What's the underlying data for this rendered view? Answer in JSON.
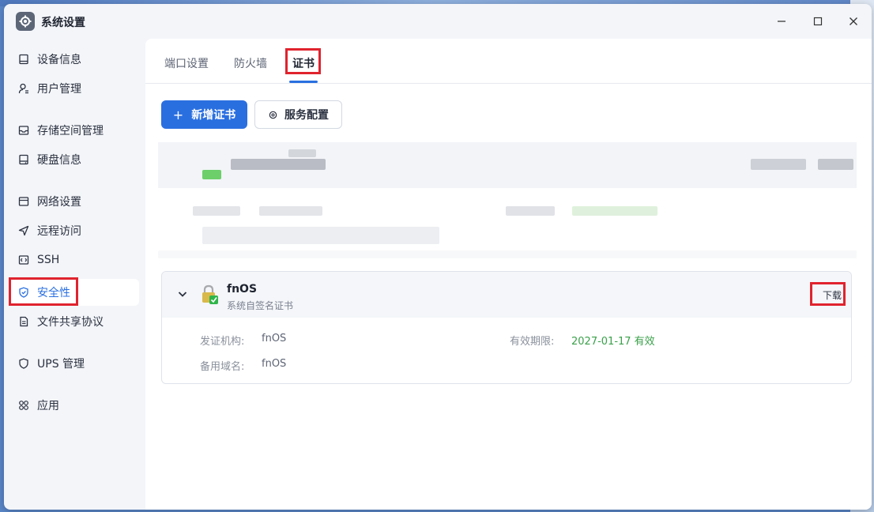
{
  "window": {
    "title": "系统设置"
  },
  "sidebar": {
    "items": [
      {
        "label": "设备信息",
        "icon": "monitor-icon"
      },
      {
        "label": "用户管理",
        "icon": "user-icon"
      },
      {
        "label": "存储空间管理",
        "icon": "storage-icon"
      },
      {
        "label": "硬盘信息",
        "icon": "disk-icon"
      },
      {
        "label": "网络设置",
        "icon": "network-icon"
      },
      {
        "label": "远程访问",
        "icon": "send-icon"
      },
      {
        "label": "SSH",
        "icon": "code-icon"
      },
      {
        "label": "安全性",
        "icon": "shield-icon",
        "active": true
      },
      {
        "label": "文件共享协议",
        "icon": "document-icon"
      },
      {
        "label": "UPS 管理",
        "icon": "shield-outline-icon"
      },
      {
        "label": "应用",
        "icon": "grid-icon"
      }
    ]
  },
  "tabs": [
    {
      "label": "端口设置"
    },
    {
      "label": "防火墙"
    },
    {
      "label": "证书",
      "active": true
    }
  ],
  "toolbar": {
    "add_label": "新增证书",
    "service_label": "服务配置"
  },
  "certificate": {
    "name": "fnOS",
    "subtitle": "系统自签名证书",
    "download_label": "下载",
    "issuer_label": "发证机构:",
    "issuer_value": "fnOS",
    "validity_label": "有效期限:",
    "validity_value": "2027-01-17 有效",
    "alt_name_label": "备用域名:",
    "alt_name_value": "fnOS"
  },
  "colors": {
    "accent": "#2a6fe0",
    "highlight": "#e0232e",
    "valid": "#3aa14a"
  }
}
